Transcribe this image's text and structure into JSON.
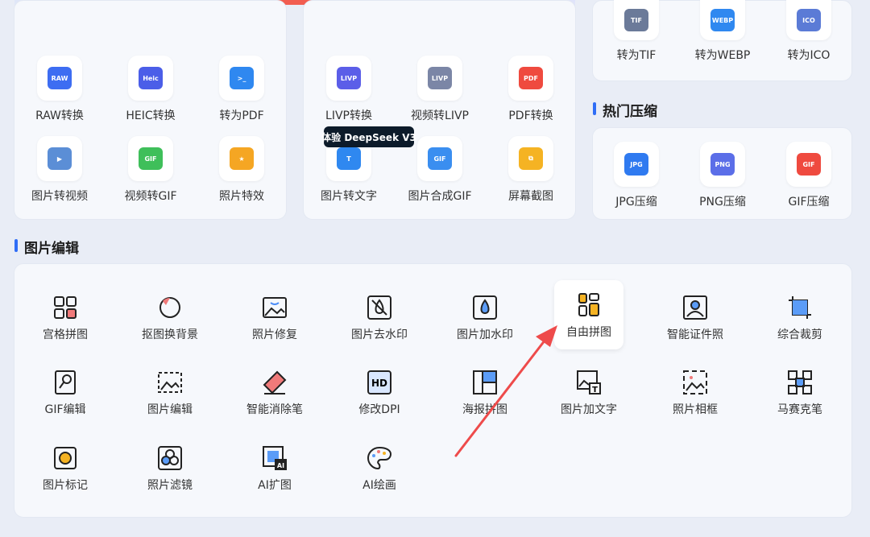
{
  "top_cards": {
    "left": {
      "tools": [
        {
          "label": "RAW转换",
          "icon": "raw-file-icon"
        },
        {
          "label": "HEIC转换",
          "icon": "heic-file-icon"
        },
        {
          "label": "转为PDF",
          "icon": "pdf-export-icon"
        },
        {
          "label": "图片转视频",
          "icon": "image-to-video-icon"
        },
        {
          "label": "视频转GIF",
          "icon": "video-to-gif-icon"
        },
        {
          "label": "照片特效",
          "icon": "photo-effect-icon"
        }
      ]
    },
    "middle": {
      "tools": [
        {
          "label": "LIVP转换",
          "icon": "livp-file-icon"
        },
        {
          "label": "视频转LIVP",
          "icon": "video-to-livp-icon"
        },
        {
          "label": "PDF转换",
          "icon": "pdf-convert-icon"
        },
        {
          "label": "图片转文字",
          "icon": "image-to-text-icon"
        },
        {
          "label": "图片合成GIF",
          "icon": "gif-compose-icon"
        },
        {
          "label": "屏幕截图",
          "icon": "screenshot-icon"
        }
      ],
      "badge": "体验 DeepSeek V3"
    },
    "right": {
      "tools": [
        {
          "label": "转为TIF",
          "icon": "tif-file-icon"
        },
        {
          "label": "转为WEBP",
          "icon": "webp-file-icon"
        },
        {
          "label": "转为ICO",
          "icon": "ico-file-icon"
        }
      ]
    }
  },
  "compress_section": {
    "title": "热门压缩",
    "tools": [
      {
        "label": "JPG压缩",
        "icon": "jpg-compress-icon"
      },
      {
        "label": "PNG压缩",
        "icon": "png-compress-icon"
      },
      {
        "label": "GIF压缩",
        "icon": "gif-compress-icon"
      }
    ]
  },
  "edit_section": {
    "title": "图片编辑",
    "tools": [
      {
        "label": "宫格拼图",
        "icon": "grid-collage-icon"
      },
      {
        "label": "抠图换背景",
        "icon": "cutout-background-icon"
      },
      {
        "label": "照片修复",
        "icon": "photo-repair-icon"
      },
      {
        "label": "图片去水印",
        "icon": "remove-watermark-icon"
      },
      {
        "label": "图片加水印",
        "icon": "add-watermark-icon"
      },
      {
        "label": "自由拼图",
        "icon": "free-collage-icon"
      },
      {
        "label": "智能证件照",
        "icon": "id-photo-icon"
      },
      {
        "label": "综合裁剪",
        "icon": "crop-icon"
      },
      {
        "label": "GIF编辑",
        "icon": "gif-edit-icon"
      },
      {
        "label": "图片编辑",
        "icon": "image-edit-icon"
      },
      {
        "label": "智能消除笔",
        "icon": "eraser-pen-icon"
      },
      {
        "label": "修改DPI",
        "icon": "hd-dpi-icon"
      },
      {
        "label": "海报拼图",
        "icon": "poster-collage-icon"
      },
      {
        "label": "图片加文字",
        "icon": "add-text-icon"
      },
      {
        "label": "照片相框",
        "icon": "photo-frame-icon"
      },
      {
        "label": "马赛克笔",
        "icon": "mosaic-icon"
      },
      {
        "label": "图片标记",
        "icon": "image-mark-icon"
      },
      {
        "label": "照片滤镜",
        "icon": "photo-filter-icon"
      },
      {
        "label": "AI扩图",
        "icon": "ai-expand-icon"
      },
      {
        "label": "AI绘画",
        "icon": "ai-paint-icon"
      }
    ]
  },
  "colors": {
    "accent": "#2f6df6",
    "arrow": "#ee4b4b"
  }
}
